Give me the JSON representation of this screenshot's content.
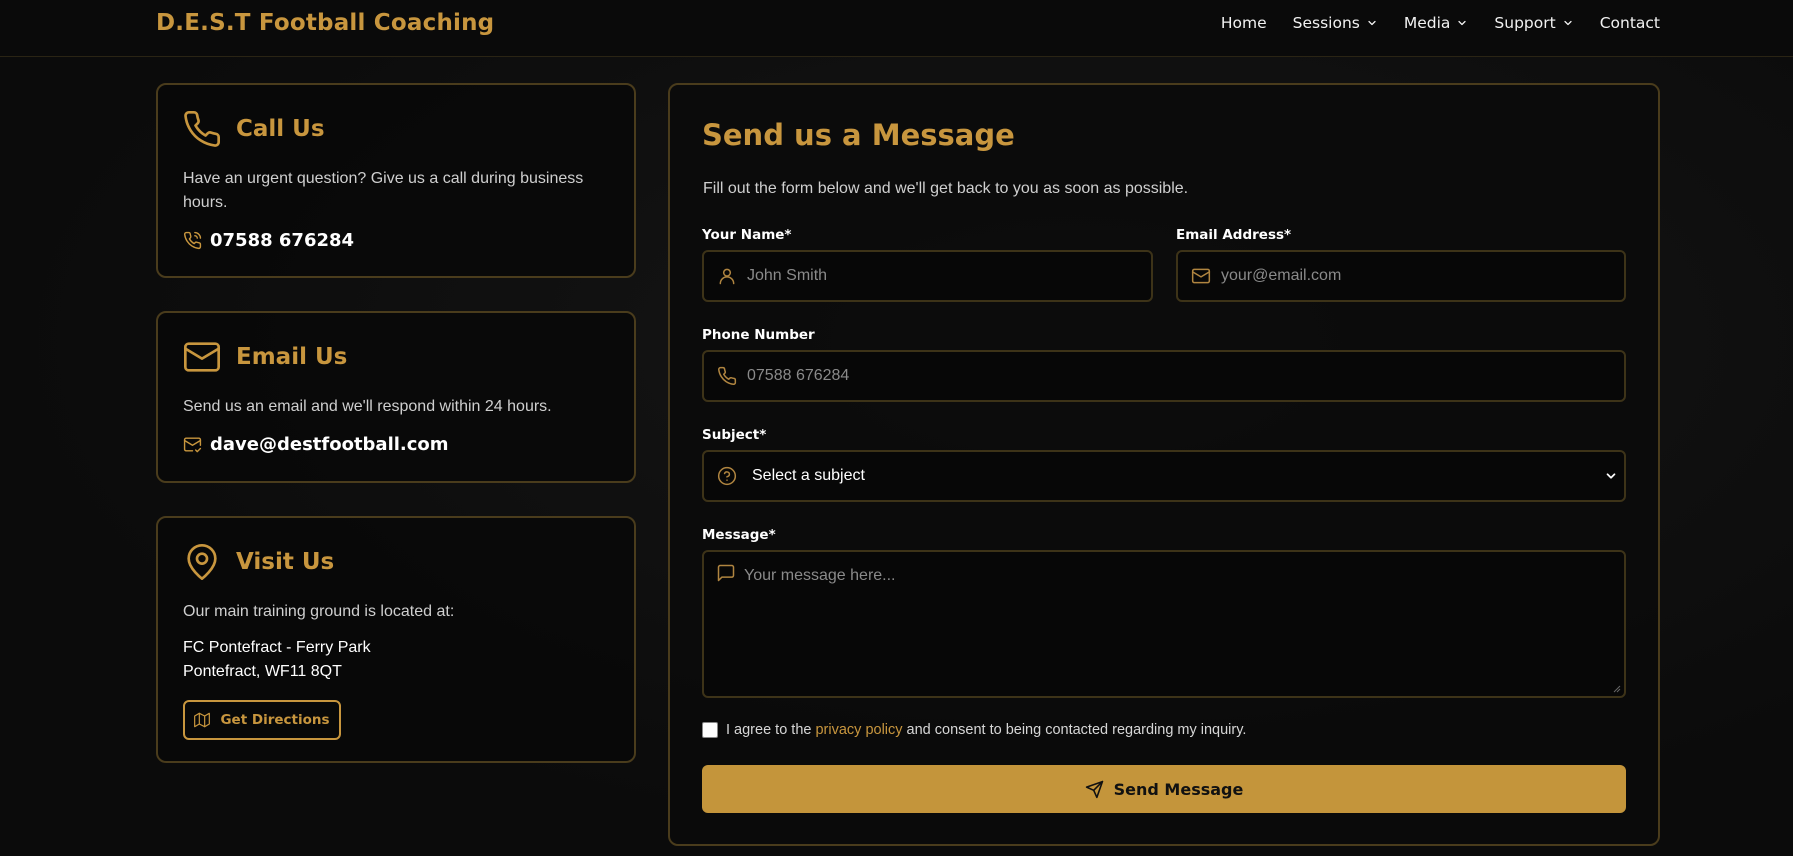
{
  "brand": "D.E.S.T Football Coaching",
  "nav": [
    {
      "label": "Home",
      "dropdown": false
    },
    {
      "label": "Sessions",
      "dropdown": true
    },
    {
      "label": "Media",
      "dropdown": true
    },
    {
      "label": "Support",
      "dropdown": true
    },
    {
      "label": "Contact",
      "dropdown": false
    }
  ],
  "call": {
    "title": "Call Us",
    "text": "Have an urgent question? Give us a call during business hours.",
    "phone": "07588 676284",
    "icon": "phone-icon"
  },
  "email": {
    "title": "Email Us",
    "text": "Send us an email and we'll respond within 24 hours.",
    "address": "dave@destfootball.com",
    "icon": "mail-icon"
  },
  "visit": {
    "title": "Visit Us",
    "text": "Our main training ground is located at:",
    "line1": "FC Pontefract - Ferry Park",
    "line2": "Pontefract, WF11 8QT",
    "button": "Get Directions",
    "icon": "map-pin-icon"
  },
  "form": {
    "title": "Send us a Message",
    "subtitle": "Fill out the form below and we'll get back to you as soon as possible.",
    "name_label": "Your Name*",
    "name_placeholder": "John Smith",
    "email_label": "Email Address*",
    "email_placeholder": "your@email.com",
    "phone_label": "Phone Number",
    "phone_placeholder": "07588 676284",
    "subject_label": "Subject*",
    "subject_value": "Select a subject",
    "message_label": "Message*",
    "message_placeholder": "Your message here...",
    "consent_before": "I agree to the ",
    "consent_link": "privacy policy",
    "consent_after": " and consent to being contacted regarding my inquiry.",
    "submit": "Send Message"
  },
  "colors": {
    "accent": "#c8963e",
    "background": "#0d0d0d",
    "border": "#4a3c1c",
    "button": "#c4953b"
  }
}
